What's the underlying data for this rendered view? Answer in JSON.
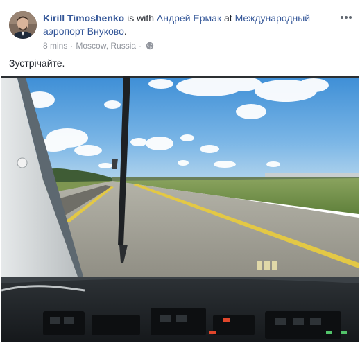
{
  "post": {
    "author_name": "Kirill Timoshenko",
    "with_text": " is with ",
    "tagged_person": "Андрей Ермак",
    "at_text": " at ",
    "location_name": "Международный аэропорт Внуково",
    "location_period": ".",
    "timestamp": "8 mins",
    "place": "Moscow, Russia",
    "separator": "·",
    "privacy_icon": "globe-icon",
    "more_icon": "more-options-icon",
    "caption": "Зустрічайте."
  },
  "photo": {
    "description_icon": "photo",
    "scene": "cockpit-view-runway"
  },
  "colors": {
    "link": "#365899",
    "text": "#1d2129",
    "meta": "#90949c",
    "sky": "#4f9ad8",
    "grass": "#6f8f47",
    "runway": "#a7a59a",
    "runway_line": "#e2c94a"
  }
}
